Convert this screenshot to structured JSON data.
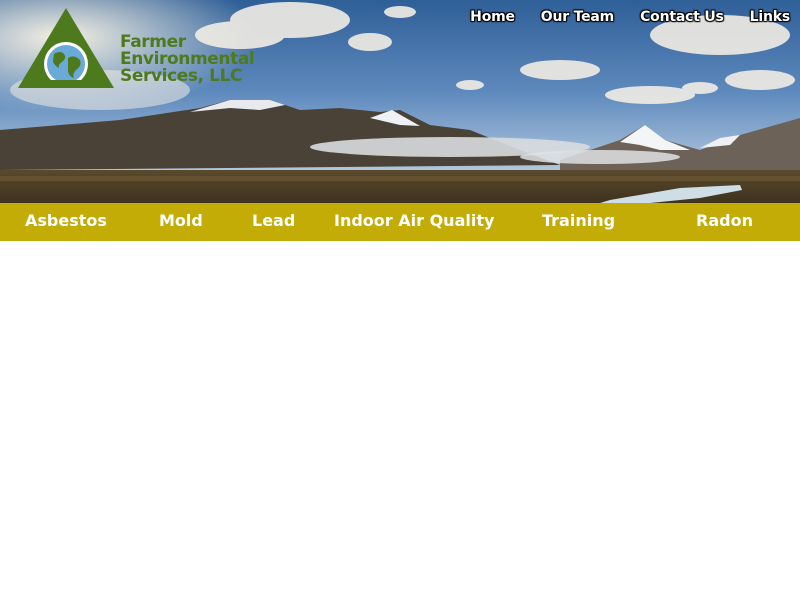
{
  "logo": {
    "line1": "Farmer",
    "line2": "Environmental",
    "line3": "Services, LLC",
    "brand_green": "#4e7a1e"
  },
  "top_nav": [
    "Home",
    "Our Team",
    "Contact Us",
    "Links"
  ],
  "main_nav": [
    "Asbestos",
    "Mold",
    "Lead",
    "Indoor Air Quality",
    "Training",
    "Radon"
  ],
  "colors": {
    "nav_bar": "#c3ac06",
    "sky_top": "#2f5f97",
    "page_background": "#ffffff"
  }
}
